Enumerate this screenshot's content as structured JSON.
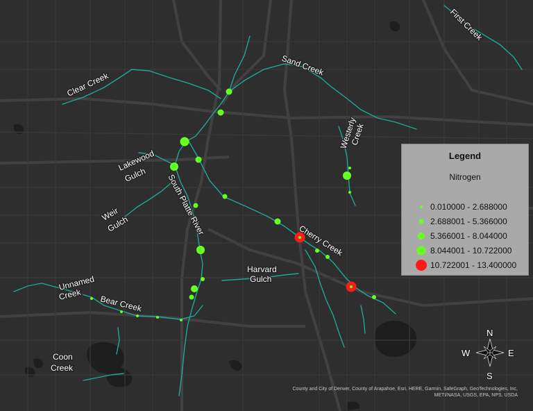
{
  "creeks": {
    "first": "First Creek",
    "sand": "Sand Creek",
    "clear": "Clear Creek",
    "westerly_1": "Westerly",
    "westerly_2": "Creek",
    "lakewood_1": "Lakewood",
    "lakewood_2": "Gulch",
    "south_platte": "South Platte River",
    "weir_1": "Weir",
    "weir_2": "Gulch",
    "cherry": "Cherry Creek",
    "harvard_1": "Harvard",
    "harvard_2": "Gulch",
    "unnamed_1": "Unnamed",
    "unnamed_2": "Creek",
    "bear": "Bear Creek",
    "coon_1": "Coon",
    "coon_2": "Creek"
  },
  "legend": {
    "title": "Legend",
    "layer": "Nitrogen",
    "classes": [
      {
        "label": "0.010000 - 2.688000",
        "color": "#66ff22"
      },
      {
        "label": "2.688001 - 5.366000",
        "color": "#66ff22"
      },
      {
        "label": "5.366001 - 8.044000",
        "color": "#66ff22"
      },
      {
        "label": "8.044001 - 10.722000",
        "color": "#66ff22"
      },
      {
        "label": "10.722001 - 13.400000",
        "color": "#ff1a1a"
      }
    ]
  },
  "compass": {
    "n": "N",
    "s": "S",
    "e": "E",
    "w": "W"
  },
  "attribution": {
    "line1": "County and City of Denver, County of Arapahoe, Esri, HERE, Garmin, SafeGraph, GeoTechnologies, Inc,",
    "line2": "METI/NASA, USGS, EPA, NPS, USDA"
  },
  "colors": {
    "water": "#1fa89a",
    "background": "#2e2e2e",
    "roads": "#3f3f3f",
    "low_class": "#66ff22",
    "high_class": "#ff1a1a"
  }
}
